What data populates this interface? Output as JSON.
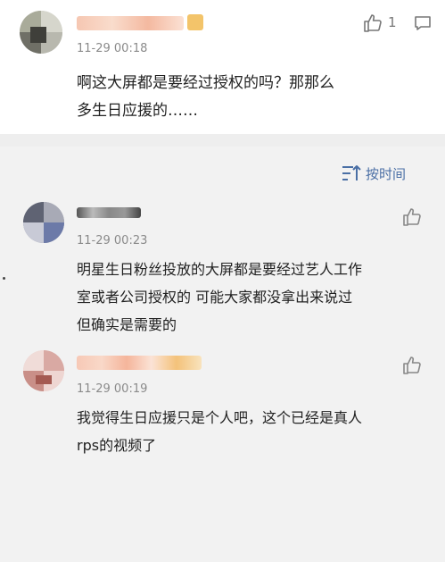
{
  "main_comment": {
    "timestamp": "11-29 00:18",
    "text_line1": "啊这大屏都是要经过授权的吗？那那么",
    "text_line2": "多生日应援的……",
    "like_count": "1"
  },
  "sort": {
    "label": "按时间"
  },
  "replies": [
    {
      "timestamp": "11-29 00:23",
      "text_line1": "明星生日粉丝投放的大屏都是要经过艺人工作",
      "text_line2": "室或者公司授权的 可能大家都没拿出来说过",
      "text_line3": "但确实是需要的"
    },
    {
      "timestamp": "11-29 00:19",
      "text_line1": "我觉得生日应援只是个人吧，这个已经是真人",
      "text_line2": "rps的视频了"
    }
  ],
  "colors": {
    "accent": "#4a6fa5",
    "muted": "#8a8a8a"
  },
  "icons": [
    "thumbs-up-icon",
    "share-icon",
    "sort-icon"
  ]
}
